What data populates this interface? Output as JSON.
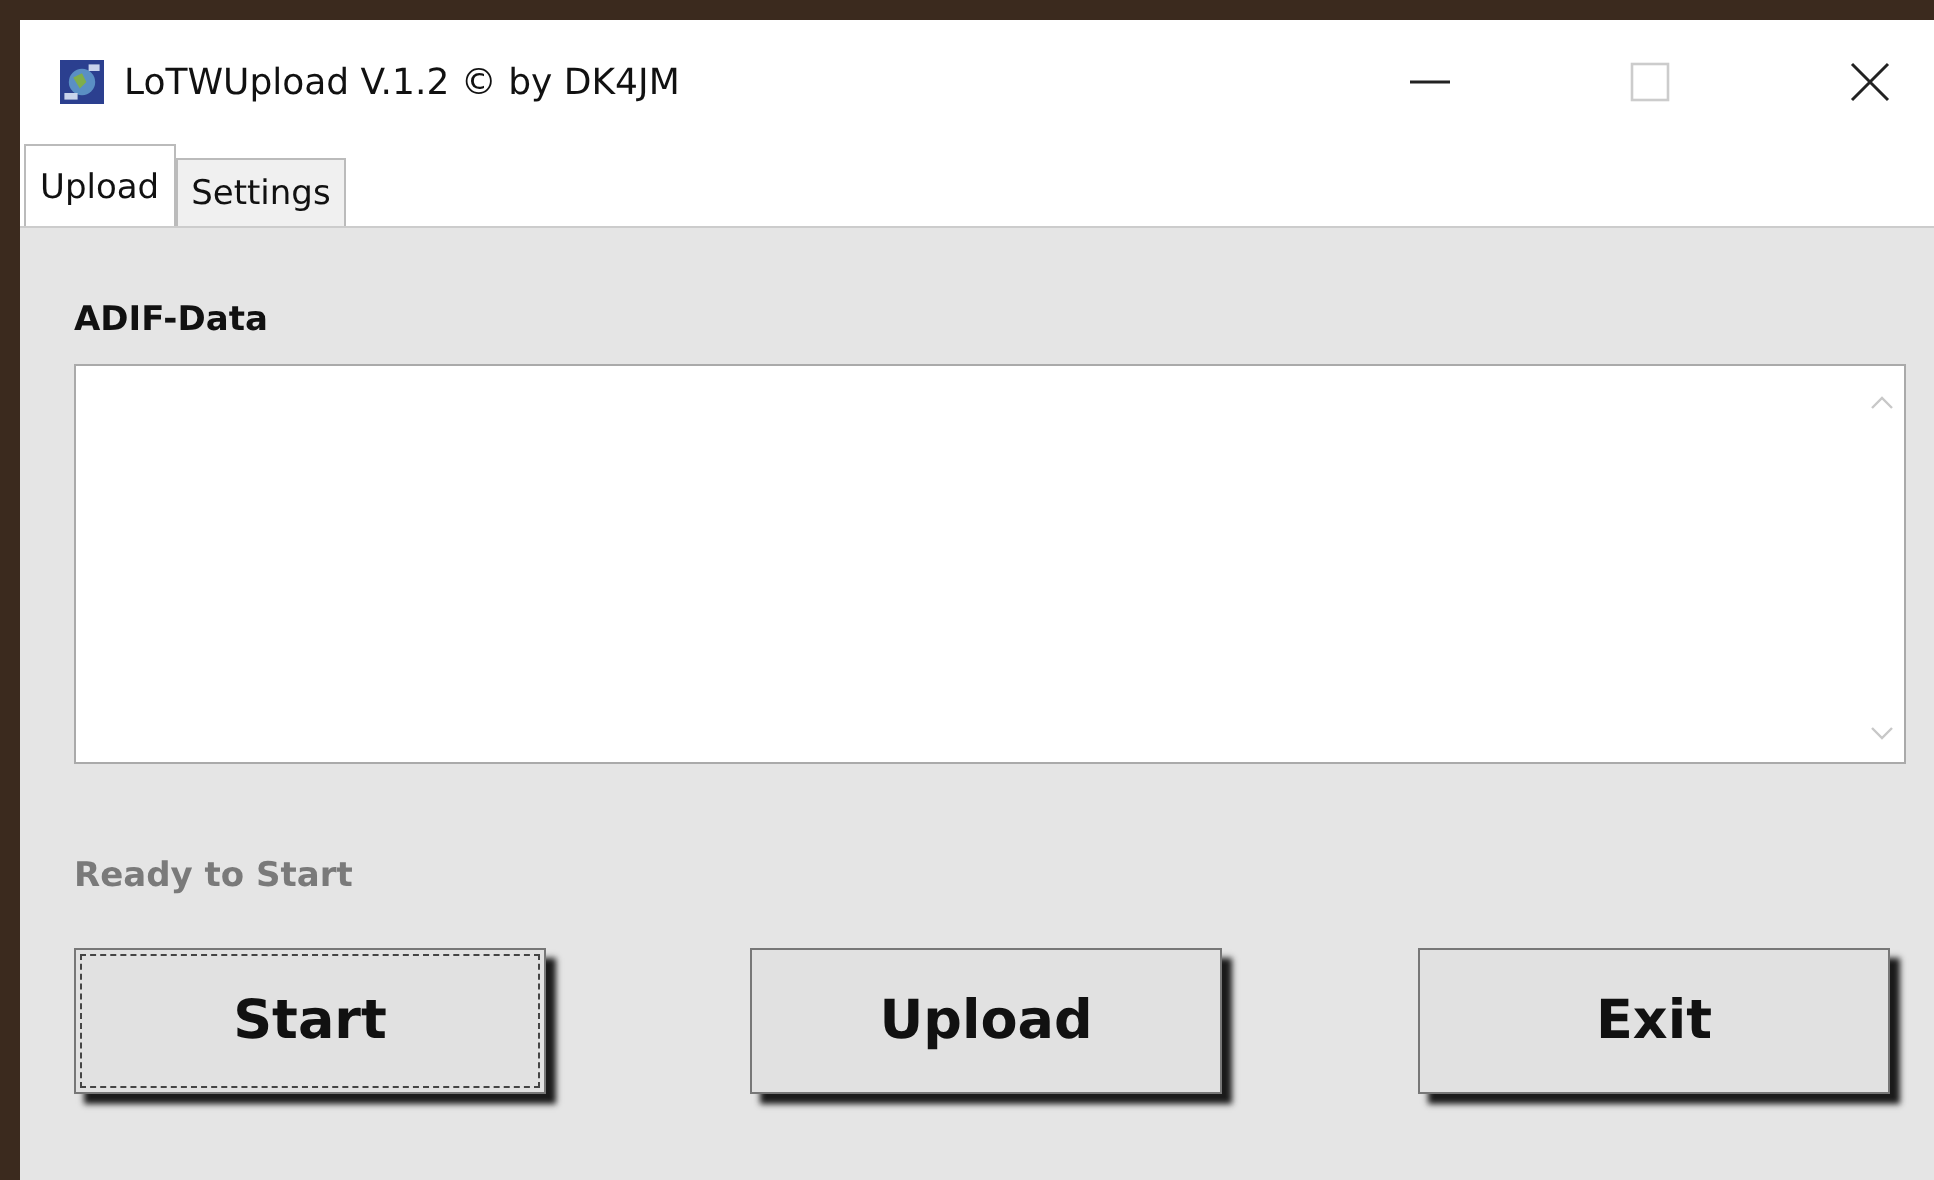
{
  "window": {
    "title": "LoTWUpload V.1.2 © by DK4JM"
  },
  "tabs": [
    {
      "label": "Upload",
      "selected": true
    },
    {
      "label": "Settings",
      "selected": false
    }
  ],
  "adif": {
    "label": "ADIF-Data"
  },
  "status": "Ready to Start",
  "buttons": [
    {
      "label": "Start",
      "focused": true
    },
    {
      "label": "Upload",
      "focused": false
    },
    {
      "label": "Exit",
      "focused": false
    }
  ]
}
